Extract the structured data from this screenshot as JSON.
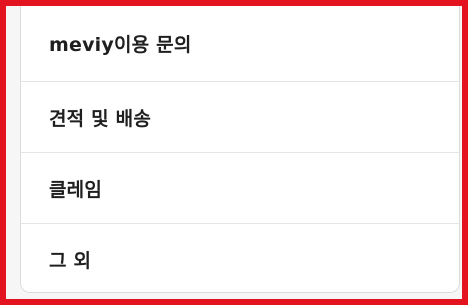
{
  "menu": {
    "items": [
      {
        "label": "meviy이용 문의"
      },
      {
        "label": "견적 및 배송"
      },
      {
        "label": "클레임"
      },
      {
        "label": "그 외"
      }
    ]
  },
  "colors": {
    "frame_border": "#e3141f",
    "divider": "#e5e5e5",
    "text": "#1f1f1f"
  }
}
